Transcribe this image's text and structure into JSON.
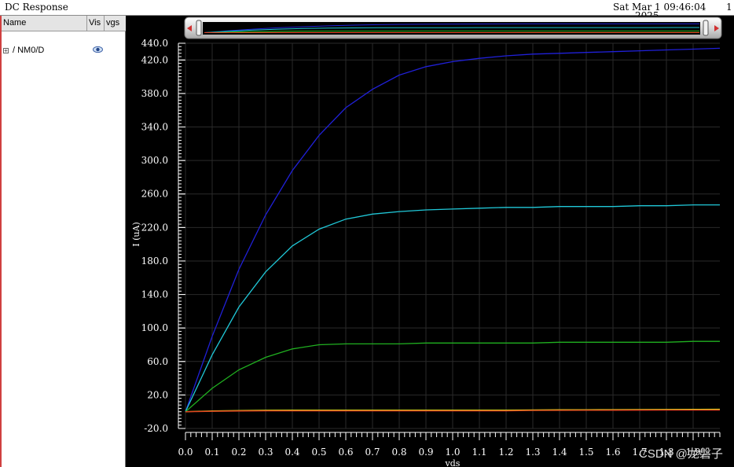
{
  "window": {
    "title": "DC Response",
    "date": "Sat Mar 1 09:46:04",
    "year": "2025",
    "page": "1"
  },
  "signal_browser": {
    "columns": [
      "Name",
      "Vis",
      "vgs"
    ],
    "signals": [
      {
        "name": "/ NM0/D",
        "visible_icon": "eye-icon",
        "expand_icon": "plus-box-icon"
      }
    ]
  },
  "watermark": "CSDN @龙磐子",
  "colors": {
    "background": "#000000",
    "grid": "#2a2a2a",
    "axis": "#ffffff"
  },
  "chart_data": {
    "type": "line",
    "xlabel": "vds",
    "ylabel": "I (uA)",
    "xlim": [
      0.0,
      2.0
    ],
    "ylim": [
      -20.0,
      440.0
    ],
    "x_ticks": [
      0.0,
      0.1,
      0.2,
      0.3,
      0.4,
      0.5,
      0.6,
      0.7,
      0.8,
      0.9,
      1.0,
      1.1,
      1.2,
      1.3,
      1.4,
      1.5,
      1.6,
      1.7,
      1.8,
      1.9
    ],
    "x_tick_labels": [
      "0.0",
      "0.1",
      "0.2",
      "0.3",
      "0.4",
      "0.5",
      "0.6",
      "0.7",
      "0.8",
      "0.9",
      "1.0",
      "1.1",
      "1.2",
      "1.3",
      "1.4",
      "1.5",
      "1.6",
      "1.7",
      "1.8",
      "1.9"
    ],
    "y_ticks": [
      -20.0,
      20.0,
      60.0,
      100.0,
      140.0,
      180.0,
      220.0,
      260.0,
      300.0,
      340.0,
      380.0,
      420.0,
      440.0
    ],
    "y_tick_labels": [
      "-20.0",
      "20.0",
      "60.0",
      "100.0",
      "140.0",
      "180.0",
      "220.0",
      "260.0",
      "300.0",
      "340.0",
      "380.0",
      "420.0",
      "440.0"
    ],
    "grid": true,
    "x": [
      0.0,
      0.1,
      0.2,
      0.3,
      0.4,
      0.5,
      0.6,
      0.7,
      0.8,
      0.9,
      1.0,
      1.1,
      1.2,
      1.3,
      1.4,
      1.5,
      1.6,
      1.7,
      1.8,
      1.9,
      2.0
    ],
    "series": [
      {
        "color": "#2020d8",
        "values": [
          0,
          90,
          170,
          235,
          288,
          330,
          363,
          385,
          402,
          412,
          418,
          422,
          425,
          427,
          428,
          429,
          430,
          431,
          432,
          433,
          434
        ]
      },
      {
        "color": "#20c8d8",
        "values": [
          0,
          68,
          125,
          167,
          198,
          218,
          230,
          236,
          239,
          241,
          242,
          243,
          244,
          244,
          245,
          245,
          245,
          246,
          246,
          247,
          247
        ]
      },
      {
        "color": "#20b020",
        "values": [
          0,
          28,
          50,
          65,
          75,
          80,
          81,
          81,
          81,
          82,
          82,
          82,
          82,
          82,
          83,
          83,
          83,
          83,
          83,
          84,
          84
        ]
      },
      {
        "color": "#d8d020",
        "values": [
          0,
          1,
          1.5,
          1.8,
          2,
          2,
          2,
          2,
          2,
          2,
          2,
          2,
          2,
          2.2,
          2.3,
          2.4,
          2.5,
          2.6,
          2.7,
          2.8,
          3
        ]
      },
      {
        "color": "#e04020",
        "values": [
          0,
          0.5,
          0.8,
          1,
          1,
          1,
          1,
          1,
          1,
          1,
          1,
          1,
          1,
          1.5,
          1.6,
          1.7,
          1.8,
          1.9,
          2,
          2,
          2
        ]
      }
    ]
  }
}
